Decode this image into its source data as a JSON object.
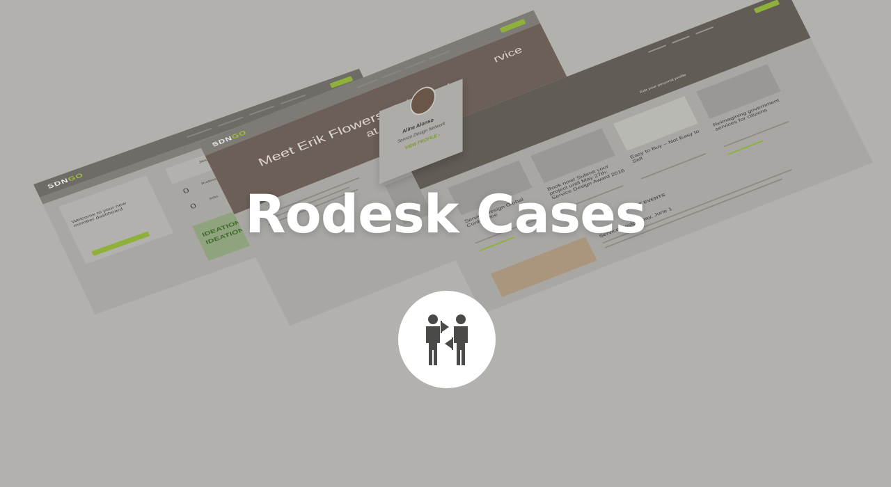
{
  "title": "Rodesk Cases",
  "background_color": "#b2b1ae",
  "accent_color": "#8fb13a",
  "icon": "two-people-flag-icon",
  "mockups": {
    "brand": "SDN",
    "brand_accent": "GO",
    "left": {
      "welcome": "Welcome to your new member dashboard",
      "user": "Jesper van Orden",
      "counter_professional": "0",
      "counter_jobs": "0",
      "professional_label": "Professional Certification",
      "jobs_label": "Jobs",
      "ideation_1": "IDEATION",
      "ideation_2": "IDEATION"
    },
    "middle": {
      "hero_title": "Meet Erik Flowers, Principal",
      "hero_subtitle": "at Intuit",
      "hero_small": "rvice"
    },
    "right": {
      "profile_link": "Edit your personal profile",
      "article_1": "Book now! Submit your project until May 27th: Service Design Award 2016",
      "article_2": "Easy to Buy – Not Easy to Sell",
      "article_3": "Reimagining government services for citizens",
      "article_4": "Service Design Global Conference",
      "events_heading": "LATEST EVENTS",
      "event_1": "Service Design Day, June 1"
    },
    "popup": {
      "name": "Aline Alonso",
      "org": "Service Design Network",
      "link": "VIEW PROFILE ›"
    }
  }
}
